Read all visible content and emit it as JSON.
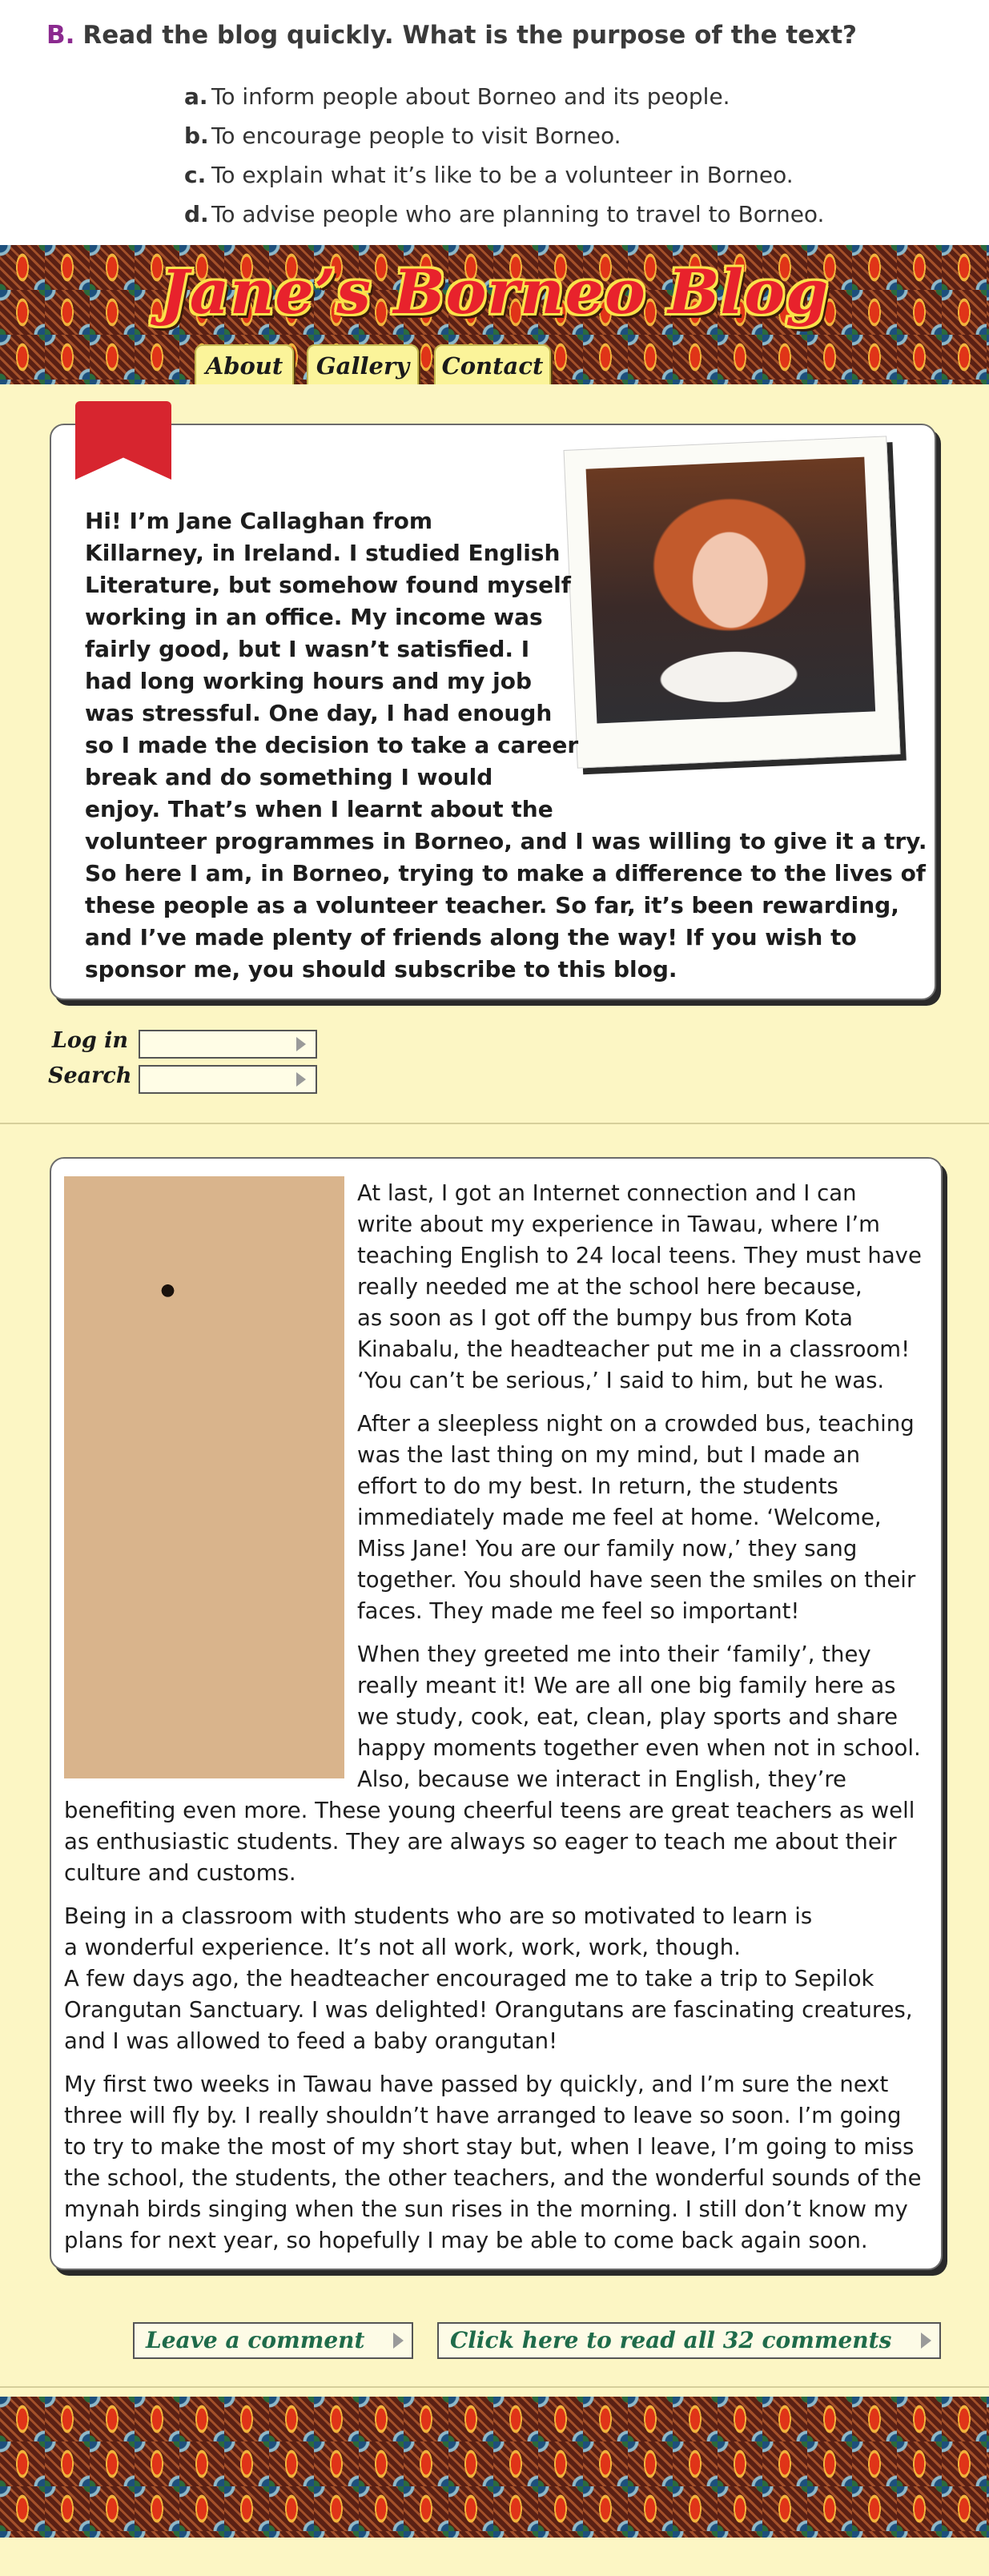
{
  "question": {
    "letter": "B.",
    "prompt": "Read the blog quickly. What is the purpose of the text?",
    "options": [
      {
        "key": "a.",
        "text": "To inform people about Borneo and its people."
      },
      {
        "key": "b.",
        "text": "To encourage people to visit Borneo."
      },
      {
        "key": "c.",
        "text": "To explain what it’s like to be a volunteer in Borneo."
      },
      {
        "key": "d.",
        "text": "To advise people who are planning to travel to Borneo."
      }
    ]
  },
  "blog": {
    "title": "Jane’s Borneo Blog",
    "nav": [
      "About",
      "Gallery",
      "Contact"
    ]
  },
  "intro": {
    "lines": [
      "Hi! I’m Jane Callaghan from",
      "Killarney, in Ireland. I studied English",
      "Literature, but somehow found myself",
      "working in an office. My income was",
      "fairly good, but I wasn’t satisfied. I",
      "had long working hours and my job",
      "was stressful. One day, I had enough",
      "so I made the decision to take a career",
      "break and do something I would",
      "enjoy. That’s when I learnt about the",
      "volunteer programmes in Borneo, and I was willing to give it a try.",
      "So here I am, in Borneo, trying to make a difference to the lives of",
      "these people as a volunteer teacher. So far, it’s been rewarding,",
      "and I’ve made plenty of friends along the way! If you wish to",
      "sponsor me, you should subscribe to this blog."
    ]
  },
  "forms": {
    "login_label": "Log in",
    "search_label": "Search"
  },
  "post": {
    "lines": [
      "At last, I got an Internet connection and I can",
      "write about my experience in Tawau, where I’m",
      "teaching English to 24 local teens. They must have",
      "really needed me at the school here because,",
      "as soon as I got off the bumpy bus from Kota",
      "Kinabalu, the headteacher put me in a classroom!",
      "‘You can’t be serious,’ I said to him, but he was.",
      "After a sleepless night on a crowded bus, teaching",
      "was the last thing on my mind, but I made an",
      "effort to do my best. In return, the students",
      "immediately made me feel at home. ‘Welcome,",
      "Miss Jane! You are our family now,’ they sang",
      "together. You should have seen the smiles on their",
      "faces. They made me feel so important!",
      "When they greeted me into their ‘family’, they",
      "really meant it! We are all one big family here as",
      "we study, cook, eat, clean, play sports and share",
      "happy moments together even when not in school.",
      "Also, because we interact in English, they’re",
      "benefiting even more. These young cheerful teens are great teachers as well",
      "as enthusiastic students. They are always so eager to teach me about their",
      "culture and customs.",
      "Being in a classroom with students who are so motivated to learn is",
      "a wonderful experience. It’s not all work, work, work, though.",
      "A few days ago, the headteacher encouraged me to take a trip to Sepilok",
      "Orangutan Sanctuary. I was delighted! Orangutans are fascinating creatures,",
      "and I was allowed to feed a baby orangutan!",
      "My first two weeks in Tawau have passed by quickly, and I’m sure the next",
      "three will fly by. I really shouldn’t have arranged to leave so soon. I’m going",
      "to try to make the most of my short stay but, when I leave, I’m going to miss",
      "the school, the students, the other teachers, and the wonderful sounds of the",
      "mynah birds singing when the sun rises in the morning. I still don’t know my",
      "plans for next year, so hopefully I may be able to come back again soon."
    ]
  },
  "comments": {
    "leave_label": "Leave a comment",
    "read_all_label": "Click here to read all 32 comments"
  },
  "colors": {
    "title_red": "#e8222c",
    "title_outline": "#fbe24a",
    "panel": "#fcf6c4",
    "question_letter": "#8b2a8f",
    "button_text": "#1f6b4a"
  }
}
